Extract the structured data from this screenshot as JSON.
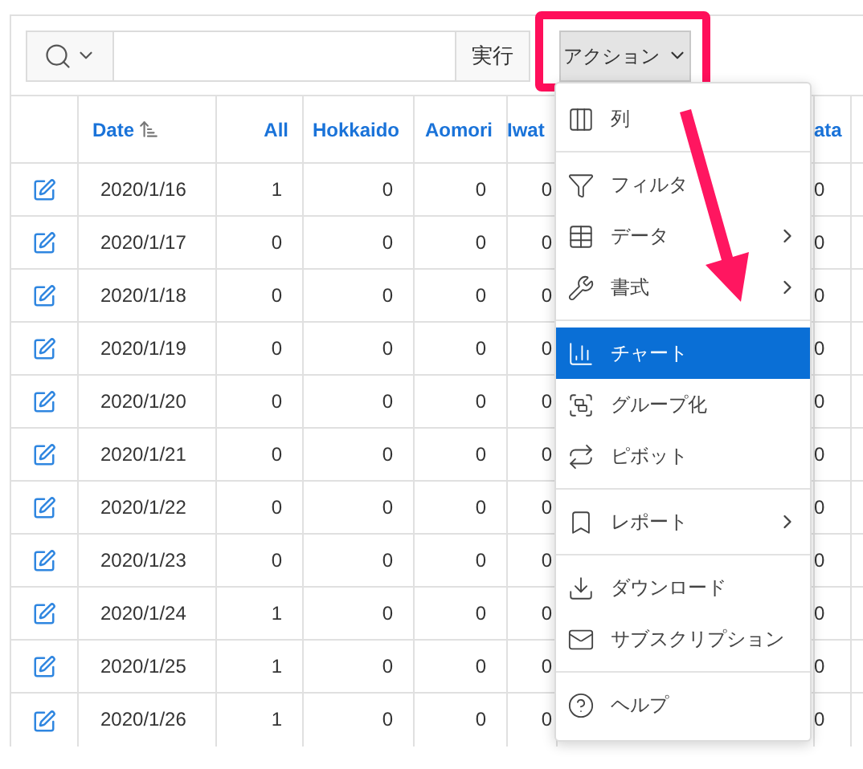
{
  "toolbar": {
    "go_button": "実行",
    "actions_button": {
      "label": "アクション",
      "expanded": true
    }
  },
  "table": {
    "columns": [
      "Date",
      "All",
      "Hokkaido",
      "Aomori",
      "Iwat",
      "ata"
    ],
    "rows": [
      {
        "date": "2020/1/16",
        "values": [
          "1",
          "0",
          "0",
          "0",
          "0"
        ]
      },
      {
        "date": "2020/1/17",
        "values": [
          "0",
          "0",
          "0",
          "0",
          "0"
        ]
      },
      {
        "date": "2020/1/18",
        "values": [
          "0",
          "0",
          "0",
          "0",
          "0"
        ]
      },
      {
        "date": "2020/1/19",
        "values": [
          "0",
          "0",
          "0",
          "0",
          "0"
        ]
      },
      {
        "date": "2020/1/20",
        "values": [
          "0",
          "0",
          "0",
          "0",
          "0"
        ]
      },
      {
        "date": "2020/1/21",
        "values": [
          "0",
          "0",
          "0",
          "0",
          "0"
        ]
      },
      {
        "date": "2020/1/22",
        "values": [
          "0",
          "0",
          "0",
          "0",
          "0"
        ]
      },
      {
        "date": "2020/1/23",
        "values": [
          "0",
          "0",
          "0",
          "0",
          "0"
        ]
      },
      {
        "date": "2020/1/24",
        "values": [
          "1",
          "0",
          "0",
          "0",
          "0"
        ]
      },
      {
        "date": "2020/1/25",
        "values": [
          "1",
          "0",
          "0",
          "0",
          "0"
        ]
      },
      {
        "date": "2020/1/26",
        "values": [
          "1",
          "0",
          "0",
          "0",
          "0"
        ]
      }
    ]
  },
  "menu": {
    "groups": [
      [
        {
          "label": "列",
          "submenu": false,
          "selected": false
        }
      ],
      [
        {
          "label": "フィルタ",
          "submenu": false,
          "selected": false
        },
        {
          "label": "データ",
          "submenu": true,
          "selected": false
        },
        {
          "label": "書式",
          "submenu": true,
          "selected": false
        }
      ],
      [
        {
          "label": "チャート",
          "submenu": false,
          "selected": true
        },
        {
          "label": "グループ化",
          "submenu": false,
          "selected": false
        },
        {
          "label": "ピボット",
          "submenu": false,
          "selected": false
        }
      ],
      [
        {
          "label": "レポート",
          "submenu": true,
          "selected": false
        }
      ],
      [
        {
          "label": "ダウンロード",
          "submenu": false,
          "selected": false
        },
        {
          "label": "サブスクリプション",
          "submenu": false,
          "selected": false
        }
      ],
      [
        {
          "label": "ヘルプ",
          "submenu": false,
          "selected": false
        }
      ]
    ]
  }
}
